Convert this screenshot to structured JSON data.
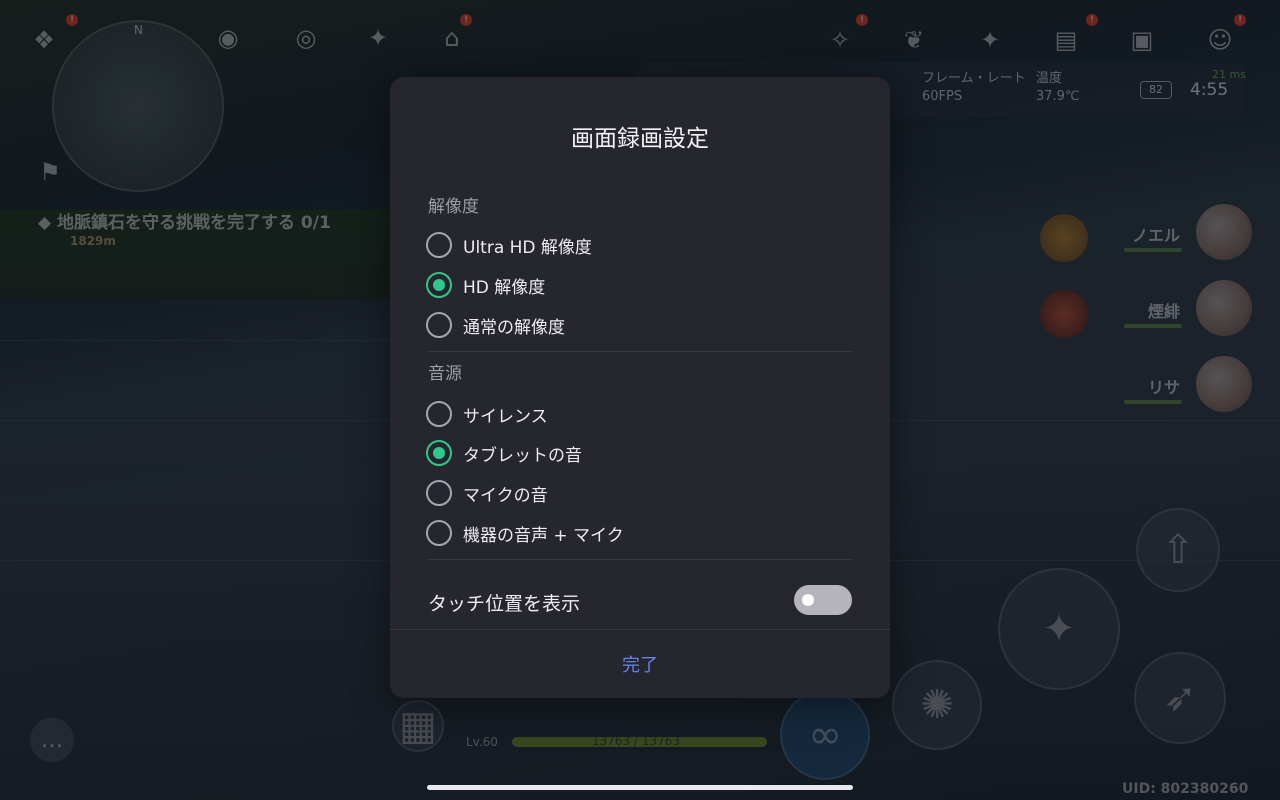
{
  "game_hud": {
    "quest_text": "地脈鎮石を守る挑戦を完了する 0/1",
    "quest_distance": "1829m",
    "compass_letter": "N",
    "stats": {
      "fps_label": "フレーム・レート",
      "fps_value": "60FPS",
      "temp_label": "温度",
      "temp_value": "37.9℃",
      "battery": "82",
      "clock": "4:55",
      "ping": "21 ms"
    },
    "party": [
      {
        "name": "ノエル"
      },
      {
        "name": "煙緋"
      },
      {
        "name": "リサ"
      }
    ],
    "level": "Lv.60",
    "hp": "13763 / 13763",
    "uid": "UID: 802380260"
  },
  "dialog": {
    "title": "画面録画設定",
    "resolution": {
      "label": "解像度",
      "options": [
        {
          "label": "Ultra HD 解像度",
          "selected": false
        },
        {
          "label": "HD 解像度",
          "selected": true
        },
        {
          "label": "通常の解像度",
          "selected": false
        }
      ]
    },
    "audio": {
      "label": "音源",
      "options": [
        {
          "label": "サイレンス",
          "selected": false
        },
        {
          "label": "タブレットの音",
          "selected": true
        },
        {
          "label": "マイクの音",
          "selected": false
        },
        {
          "label": "機器の音声 + マイク",
          "selected": false
        }
      ]
    },
    "touch_toggle": {
      "label": "タッチ位置を表示",
      "on": false
    },
    "done_label": "完了",
    "accent_color": "#2ec98a",
    "link_color": "#6a82e8"
  }
}
